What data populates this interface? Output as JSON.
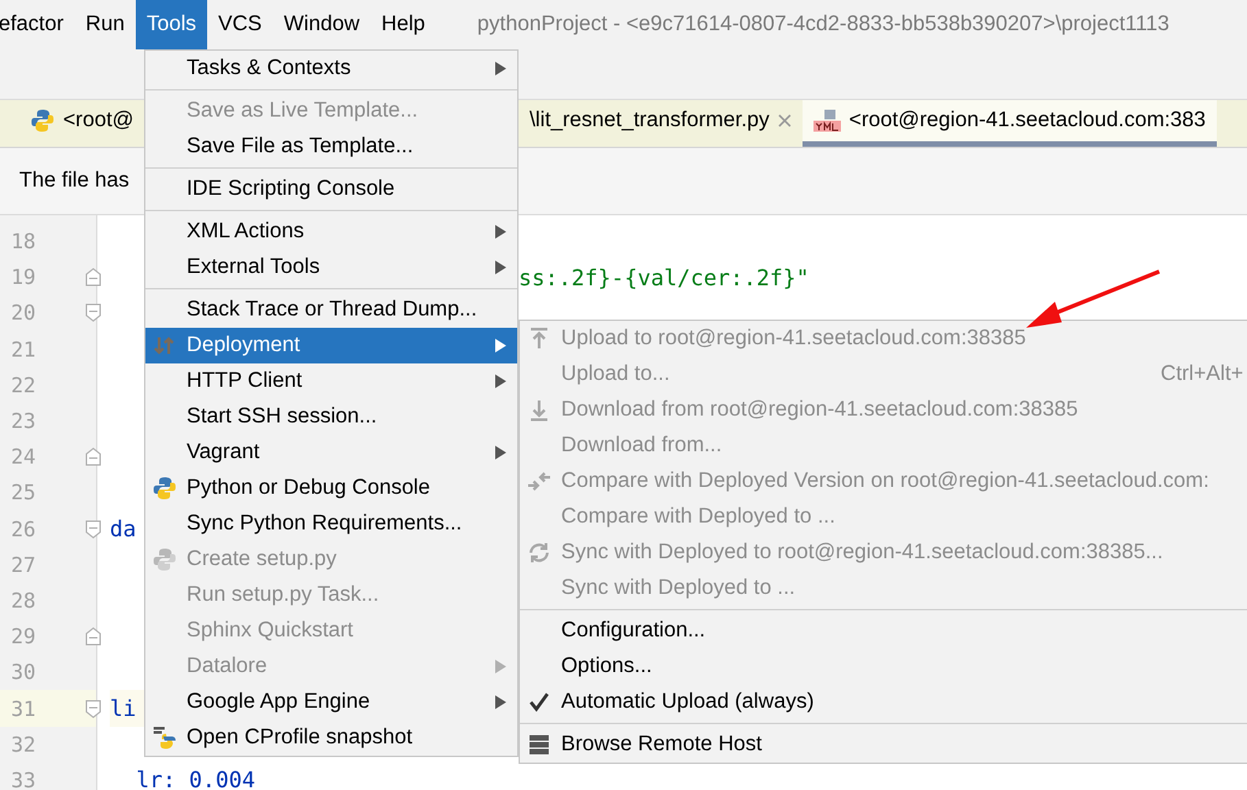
{
  "menubar": {
    "items": [
      {
        "label": "efactor",
        "selected": false
      },
      {
        "label": "Run",
        "selected": false
      },
      {
        "label": "Tools",
        "selected": true
      },
      {
        "label": "VCS",
        "selected": false
      },
      {
        "label": "Window",
        "selected": false
      },
      {
        "label": "Help",
        "selected": false
      }
    ],
    "title": "pythonProject - <e9c71614-0807-4cd2-8833-bb538b390207>\\project1113"
  },
  "tabs": [
    {
      "label": "<root@",
      "selected": false,
      "closable": false
    },
    {
      "label": "\\lit_resnet_transformer.py",
      "selected": false,
      "closable": true
    },
    {
      "label": "<root@region-41.seetacloud.com:383",
      "selected": true,
      "closable": false
    }
  ],
  "notification": {
    "text": "The file has"
  },
  "editor": {
    "lines": [
      {
        "number": "18",
        "kind": "plain",
        "current": false
      },
      {
        "number": "19",
        "right": "ss:.2f}-{val/cer:.2f}\"",
        "kind": "foldend",
        "current": false
      },
      {
        "number": "20",
        "kind": "foldstart",
        "current": false
      },
      {
        "number": "21",
        "kind": "plain",
        "current": false
      },
      {
        "number": "22",
        "kind": "plain",
        "current": false
      },
      {
        "number": "23",
        "kind": "plain",
        "current": false
      },
      {
        "number": "24",
        "kind": "foldend",
        "current": false
      },
      {
        "number": "25",
        "kind": "plain",
        "current": false
      },
      {
        "number": "26",
        "code": "da",
        "kind": "foldstart",
        "current": false
      },
      {
        "number": "27",
        "kind": "plain",
        "current": false
      },
      {
        "number": "28",
        "kind": "plain",
        "current": false
      },
      {
        "number": "29",
        "kind": "foldend",
        "current": false
      },
      {
        "number": "30",
        "kind": "plain",
        "current": false
      },
      {
        "number": "31",
        "code": "li",
        "kind": "foldstart",
        "current": true
      },
      {
        "number": "32",
        "kind": "plain",
        "current": false
      },
      {
        "number": "33",
        "code": "  lr: 0.004",
        "kind": "plain",
        "current": false
      }
    ]
  },
  "tools_menu": {
    "items": [
      {
        "kind": "item",
        "label": "Tasks & Contexts",
        "disabled": false,
        "submenu": true,
        "selected": false
      },
      {
        "kind": "separator"
      },
      {
        "kind": "item",
        "label": "Save as Live Template...",
        "disabled": true,
        "submenu": false,
        "selected": false
      },
      {
        "kind": "item",
        "label": "Save File as Template...",
        "disabled": false,
        "submenu": false,
        "selected": false
      },
      {
        "kind": "separator"
      },
      {
        "kind": "item",
        "label": "IDE Scripting Console",
        "disabled": false,
        "submenu": false,
        "selected": false
      },
      {
        "kind": "separator"
      },
      {
        "kind": "item",
        "label": "XML Actions",
        "disabled": false,
        "submenu": true,
        "selected": false
      },
      {
        "kind": "item",
        "label": "External Tools",
        "disabled": false,
        "submenu": true,
        "selected": false
      },
      {
        "kind": "separator"
      },
      {
        "kind": "item",
        "label": "Stack Trace or Thread Dump...",
        "disabled": false,
        "submenu": false,
        "selected": false
      },
      {
        "kind": "item",
        "label": "Deployment",
        "disabled": false,
        "submenu": true,
        "selected": true
      },
      {
        "kind": "item",
        "label": "HTTP Client",
        "disabled": false,
        "submenu": true,
        "selected": false
      },
      {
        "kind": "item",
        "label": "Start SSH session...",
        "disabled": false,
        "submenu": false,
        "selected": false
      },
      {
        "kind": "item",
        "label": "Vagrant",
        "disabled": false,
        "submenu": true,
        "selected": false
      },
      {
        "kind": "item",
        "label": "Python or Debug Console",
        "disabled": false,
        "submenu": false,
        "selected": false
      },
      {
        "kind": "item",
        "label": "Sync Python Requirements...",
        "disabled": false,
        "submenu": false,
        "selected": false
      },
      {
        "kind": "item",
        "label": "Create setup.py",
        "disabled": true,
        "submenu": false,
        "selected": false
      },
      {
        "kind": "item",
        "label": "Run setup.py Task...",
        "disabled": true,
        "submenu": false,
        "selected": false
      },
      {
        "kind": "item",
        "label": "Sphinx Quickstart",
        "disabled": true,
        "submenu": false,
        "selected": false
      },
      {
        "kind": "item",
        "label": "Datalore",
        "disabled": true,
        "submenu": true,
        "selected": false
      },
      {
        "kind": "item",
        "label": "Google App Engine",
        "disabled": false,
        "submenu": true,
        "selected": false
      },
      {
        "kind": "item",
        "label": "Open CProfile snapshot",
        "disabled": false,
        "submenu": false,
        "selected": false
      }
    ]
  },
  "deployment_submenu": {
    "items": [
      {
        "kind": "item",
        "label": "Upload to root@region-41.seetacloud.com:38385",
        "disabled": true,
        "checked": false
      },
      {
        "kind": "item",
        "label": "Upload to...",
        "shortcut": "Ctrl+Alt+",
        "disabled": true,
        "checked": false
      },
      {
        "kind": "item",
        "label": "Download from root@region-41.seetacloud.com:38385",
        "disabled": true,
        "checked": false
      },
      {
        "kind": "item",
        "label": "Download from...",
        "disabled": true,
        "checked": false
      },
      {
        "kind": "item",
        "label": "Compare with Deployed Version on root@region-41.seetacloud.com:",
        "disabled": true,
        "checked": false
      },
      {
        "kind": "item",
        "label": "Compare with Deployed to ...",
        "disabled": true,
        "checked": false
      },
      {
        "kind": "item",
        "label": "Sync with Deployed to root@region-41.seetacloud.com:38385...",
        "disabled": true,
        "checked": false
      },
      {
        "kind": "item",
        "label": "Sync with Deployed to ...",
        "disabled": true,
        "checked": false
      },
      {
        "kind": "separator"
      },
      {
        "kind": "item",
        "label": "Configuration...",
        "disabled": false,
        "checked": false
      },
      {
        "kind": "item",
        "label": "Options...",
        "disabled": false,
        "checked": false
      },
      {
        "kind": "item",
        "label": "Automatic Upload (always)",
        "disabled": false,
        "checked": true
      },
      {
        "kind": "separator"
      },
      {
        "kind": "item",
        "label": "Browse Remote Host",
        "disabled": false,
        "checked": false
      }
    ]
  }
}
